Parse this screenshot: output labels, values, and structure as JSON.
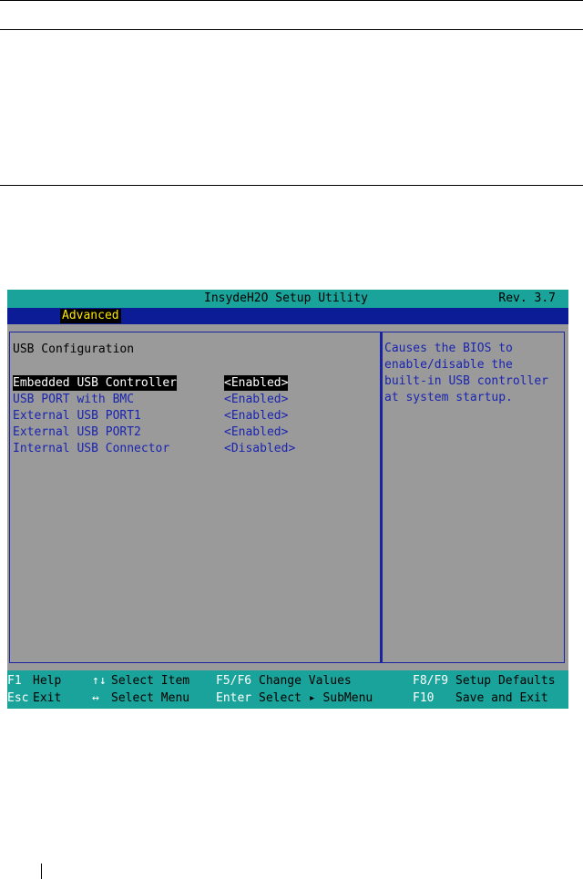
{
  "header": {
    "title": "InsydeH2O Setup Utility",
    "revision": "Rev. 3.7"
  },
  "menu": {
    "active_tab": "Advanced"
  },
  "main": {
    "section_title": "USB Configuration",
    "items": [
      {
        "label": "Embedded USB Controller",
        "value": "<Enabled>",
        "selected": true
      },
      {
        "label": "USB PORT with BMC",
        "value": "<Enabled>",
        "selected": false
      },
      {
        "label": "External USB PORT1",
        "value": "<Enabled>",
        "selected": false
      },
      {
        "label": "External USB PORT2",
        "value": "<Enabled>",
        "selected": false
      },
      {
        "label": "Internal USB Connector",
        "value": "<Disabled>",
        "selected": false
      }
    ]
  },
  "help": {
    "text": "Causes the BIOS to\nenable/disable the\nbuilt-in USB controller\nat system startup."
  },
  "footer": {
    "hints": [
      {
        "key": "F1",
        "desc": "Help"
      },
      {
        "key": "↑↓",
        "desc": "Select Item"
      },
      {
        "key": "F5/F6",
        "desc": "Change Values"
      },
      {
        "key": "F8/F9",
        "desc": "Setup Defaults"
      },
      {
        "key": "Esc",
        "desc": "Exit"
      },
      {
        "key": "↔",
        "desc": "Select Menu"
      },
      {
        "key": "Enter",
        "desc": "Select ▸ SubMenu"
      },
      {
        "key": "F10",
        "desc": "Save and Exit"
      }
    ]
  },
  "colors": {
    "title_bar": "#1aa39a",
    "menu_bar": "#0b1c96",
    "panel_bg": "#9a9a9a",
    "item_text": "#1a24b0",
    "selected_bg": "#000000",
    "tab_text": "#ffe600"
  }
}
